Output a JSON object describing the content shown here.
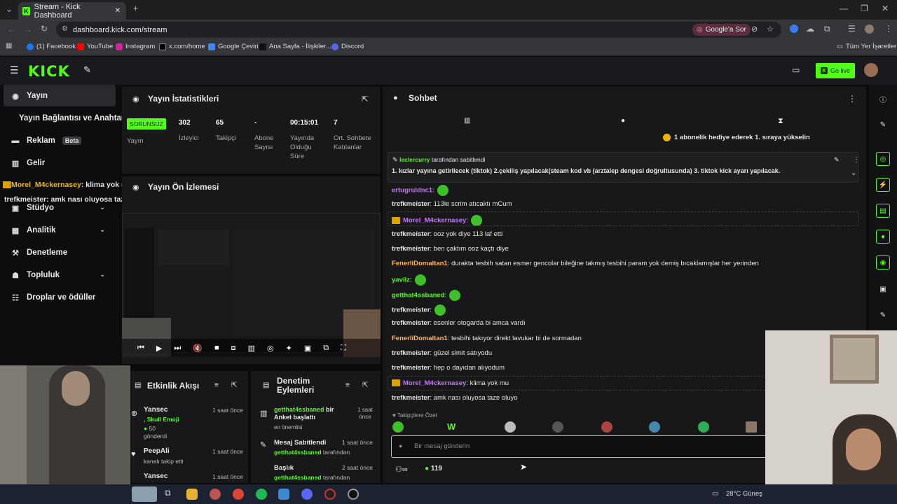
{
  "browser": {
    "tab_title": "Stream - Kick Dashboard",
    "url": "dashboard.kick.com/stream",
    "google_btn": "Google'a Sor",
    "bookmarks": [
      "(1) Facebook",
      "YouTube",
      "Instagram",
      "x.com/home",
      "Google Çeviri",
      "Ana Sayfa - İlişkiler...",
      "Discord"
    ],
    "all_bookmarks": "Tüm Yer İşaretleri"
  },
  "header": {
    "logo": "KICK",
    "golive_label": "Go live"
  },
  "sidebar": {
    "items": [
      {
        "label": "Yayın",
        "icon": "broadcast-icon"
      },
      {
        "label": "Yayın Bağlantısı ve Anahtarı"
      },
      {
        "label": "Reklam",
        "badge": "Beta",
        "icon": "ad-icon"
      },
      {
        "label": "Gelir",
        "icon": "revenue-icon"
      },
      {
        "label": "Stüdyo",
        "icon": "studio-icon"
      },
      {
        "label": "Analitik",
        "icon": "analytics-icon"
      },
      {
        "label": "Denetleme",
        "icon": "moderation-icon"
      },
      {
        "label": "Topluluk",
        "icon": "community-icon"
      },
      {
        "label": "Droplar ve ödüller",
        "icon": "drops-icon"
      }
    ]
  },
  "overlay_alerts": [
    {
      "user": "Morel_M4ckernasey",
      "text": ": klima yok mu"
    },
    {
      "user": "trefkmeister",
      "text": ": amk nası oluyosa taze oluyo"
    }
  ],
  "stats": {
    "title": "Yayın İstatistikleri",
    "status_badge": "SORUNSUZ",
    "status_label": "Yayın",
    "items": [
      {
        "value": "302",
        "label": "İzleyici"
      },
      {
        "value": "65",
        "label": "Takipçi"
      },
      {
        "value": "-",
        "label": "Abone Sayısı"
      },
      {
        "value": "00:15:01",
        "label": "Yayında Olduğu Süre"
      },
      {
        "value": "7",
        "label": "Ort. Sohbete Katılanlar"
      }
    ]
  },
  "preview": {
    "title": "Yayın Ön İzlemesi"
  },
  "activity": {
    "title": "Etkinlik Akışı",
    "items": [
      {
        "user": "Yansec",
        "detail": ", Skull Emoji",
        "amount": "50",
        "sub": "gönderdi",
        "time": "1 saat önce"
      },
      {
        "user": "PeepAli",
        "sub": "kanalı takip etti",
        "time": "1 saat önce"
      },
      {
        "user": "Yansec",
        "time": "1 saat önce"
      }
    ]
  },
  "moderation": {
    "title": "Denetim Eylemleri",
    "items": [
      {
        "title_user": "getthat4ssbaned",
        "title_rest": " bir Anket başlattı",
        "sub": "en önemlisi",
        "time": "1 saat önce"
      },
      {
        "title_user": "Mesaj Sabitlendi",
        "sub_user": "getthat4ssbaned",
        "sub_rest": " tarafından",
        "time": "1 saat önce"
      },
      {
        "title_user": "Başlık",
        "sub_user": "getthat4ssbaned",
        "sub_rest": " tarafından",
        "time": "2 saat önce"
      }
    ]
  },
  "chat": {
    "title": "Sohbet",
    "gift_banner": "1 abonelik hediye ederek 1. sıraya yükselin",
    "pinned_by_user": "leclercurry",
    "pinned_by_rest": " tarafından sabitlendi",
    "pinned_text": "1. kızlar yayına getirilecek (tiktok) 2.çekiliş yapılacak(steam kod vb (arztalep dengesi doğrultusunda) 3. tiktok kick ayarı yapılacak.",
    "messages": [
      {
        "user": "ertugruldnc1",
        "text": "",
        "color": "#c874ff",
        "emote": true
      },
      {
        "user": "trefkmeister",
        "text": " 113le scrim atıcaktı mCum",
        "color": "#e6e6e6"
      },
      {
        "user": "Morel_M4ckernasey",
        "text": "",
        "color": "#c874ff",
        "emote": true,
        "badge": true
      },
      {
        "user": "trefkmeister",
        "text": " ooz yok diye 113 laf etti",
        "color": "#e6e6e6"
      },
      {
        "user": "trefkmeister",
        "text": " ben çaktım ooz kaçtı diye",
        "color": "#e6e6e6"
      },
      {
        "user": "FenerliDomaltan1",
        "text": " durakta tesbih satan esmer gencolar bileğine takmış tesbihi param yok demiş bıcaklamışlar her yerinden",
        "color": "#ffb84d"
      },
      {
        "user": "yaviiz",
        "text": "",
        "color": "#53fc18",
        "emote": true
      },
      {
        "user": "getthat4ssbaned",
        "text": "",
        "color": "#53fc18",
        "emote": true
      },
      {
        "user": "trefkmeister",
        "text": "",
        "color": "#e6e6e6",
        "emote": true
      },
      {
        "user": "trefkmeister",
        "text": " esenler otogarda bi amca vardı",
        "color": "#e6e6e6"
      },
      {
        "user": "FenerliDomaltan1",
        "text": " tesbihi takıyor direkt lavukar bi de sormadan",
        "color": "#ffb84d"
      },
      {
        "user": "trefkmeister",
        "text": " güzel simit satıyodu",
        "color": "#e6e6e6"
      },
      {
        "user": "trefkmeister",
        "text": " hep o dayıdan alıyodum",
        "color": "#e6e6e6"
      },
      {
        "user": "Morel_M4ckernasey",
        "text": " klima yok mu",
        "color": "#c874ff",
        "badge": true
      },
      {
        "user": "trefkmeister",
        "text": " amk nası oluyosa taze oluyo",
        "color": "#e6e6e6"
      }
    ],
    "emote_section": "Takipçilere Özel",
    "input_placeholder": "Bir mesaj gönderin",
    "points": "119"
  },
  "taskbar": {
    "weather": "28°C  Güneş"
  },
  "colors": {
    "accent": "#53fc18",
    "panel": "#18181b"
  }
}
